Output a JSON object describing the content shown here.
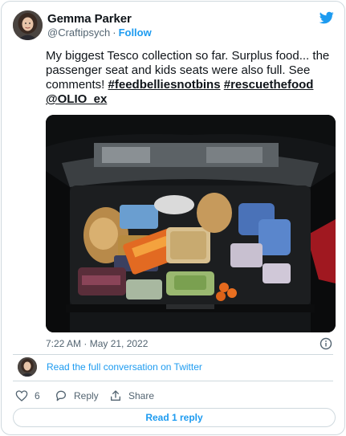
{
  "author": {
    "name": "Gemma Parker",
    "handle": "@Craftipsych",
    "separator": "·",
    "follow_label": "Follow"
  },
  "tweet": {
    "text_plain": "My biggest Tesco collection so far. Surplus food... the passenger seat and kids seats were also full. See comments!",
    "hashtag_1": "#feedbelliesnotbins",
    "hashtag_2": "#rescuethefood",
    "mention": "@OLIO_ex",
    "timestamp": "7:22 AM · May 21, 2022"
  },
  "conversation": {
    "link_label": "Read the full conversation on Twitter"
  },
  "actions": {
    "like_count": "6",
    "reply_label": "Reply",
    "share_label": "Share"
  },
  "read_reply_label": "Read 1 reply",
  "colors": {
    "accent": "#1d9bf0",
    "text_primary": "#0f1419",
    "text_secondary": "#536471",
    "border": "#cfd9de"
  },
  "icons": [
    "twitter-bird-icon",
    "info-icon",
    "heart-icon",
    "reply-icon",
    "share-icon"
  ]
}
